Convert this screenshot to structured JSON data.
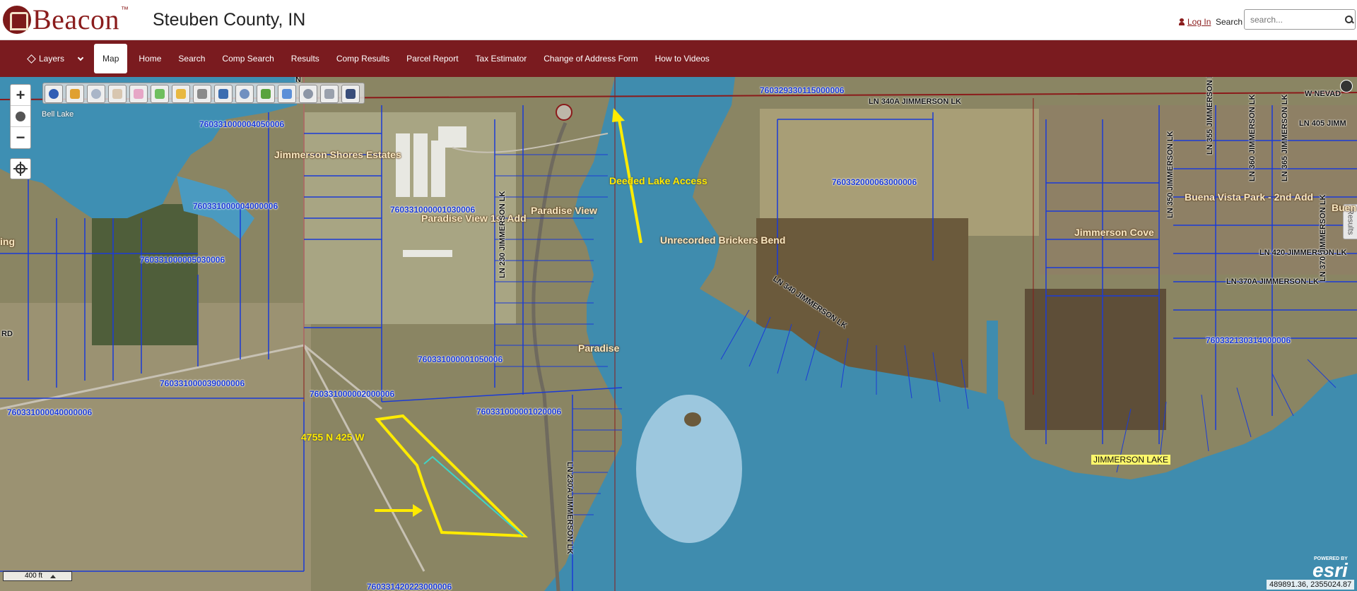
{
  "header": {
    "logo_text": "Beacon",
    "logo_tm": "™",
    "county": "Steuben County, IN",
    "login": "Log In",
    "search_label": "Search",
    "search_placeholder": "search..."
  },
  "nav": {
    "layers": "Layers",
    "items": [
      "Map",
      "Home",
      "Search",
      "Comp Search",
      "Results",
      "Comp Results",
      "Parcel Report",
      "Tax Estimator",
      "Change of Address Form",
      "How to Videos"
    ]
  },
  "map": {
    "parcels": [
      "760329330115000006",
      "760331000004050006",
      "760331000004000006",
      "760331000001030006",
      "760331000005030006",
      "760331000001050006",
      "760331000039000006",
      "760331000002000006",
      "760331000040000006",
      "760331000001020006",
      "760331420223000006",
      "760332000063000006",
      "760332130314000006"
    ],
    "subdivisions": [
      "Jimmerson Shores Estates",
      "Paradise View",
      "Paradise View 1st Add",
      "Unrecorded Brickers Bend",
      "Paradise",
      "Jimmerson Cove",
      "Buena Vista Park - 2nd Add",
      "Buen",
      "ing"
    ],
    "roads": [
      "LN 340A JIMMERSON LK",
      "LN 230 JIMMERSON LK",
      "LN 230A JIMMERSON LK",
      "LN 340 JIMMERSON LK",
      "LN 350 JIMMERSON LK",
      "LN 355 JIMMERSON LK",
      "LN 360 JIMMERSON LK",
      "LN 365 JIMMERSON LK",
      "LN 405 JIMM",
      "LN 420 JIMMERSON LK",
      "LN 370A JIMMERSON LK",
      "LN 370 JIMMERSON LK",
      "W NEVAD",
      "RD",
      "N"
    ],
    "bell_lake": "Bell Lake",
    "lake_name": "JIMMERSON LAKE",
    "annotations": {
      "deeded": "Deeded Lake Access",
      "address": "4755 N 425 W"
    },
    "scale": "400 ft",
    "coords": "489891.36, 2355024.87",
    "esri_small": "POWERED BY",
    "esri_big": "esri",
    "results_tab": "Results"
  },
  "colors": {
    "nav_bg": "#7a1b1f",
    "brand": "#8a1c1c",
    "parcel_line": "#1b3bd6",
    "water": "#3e8fb3",
    "highlight": "#ffeb00"
  }
}
